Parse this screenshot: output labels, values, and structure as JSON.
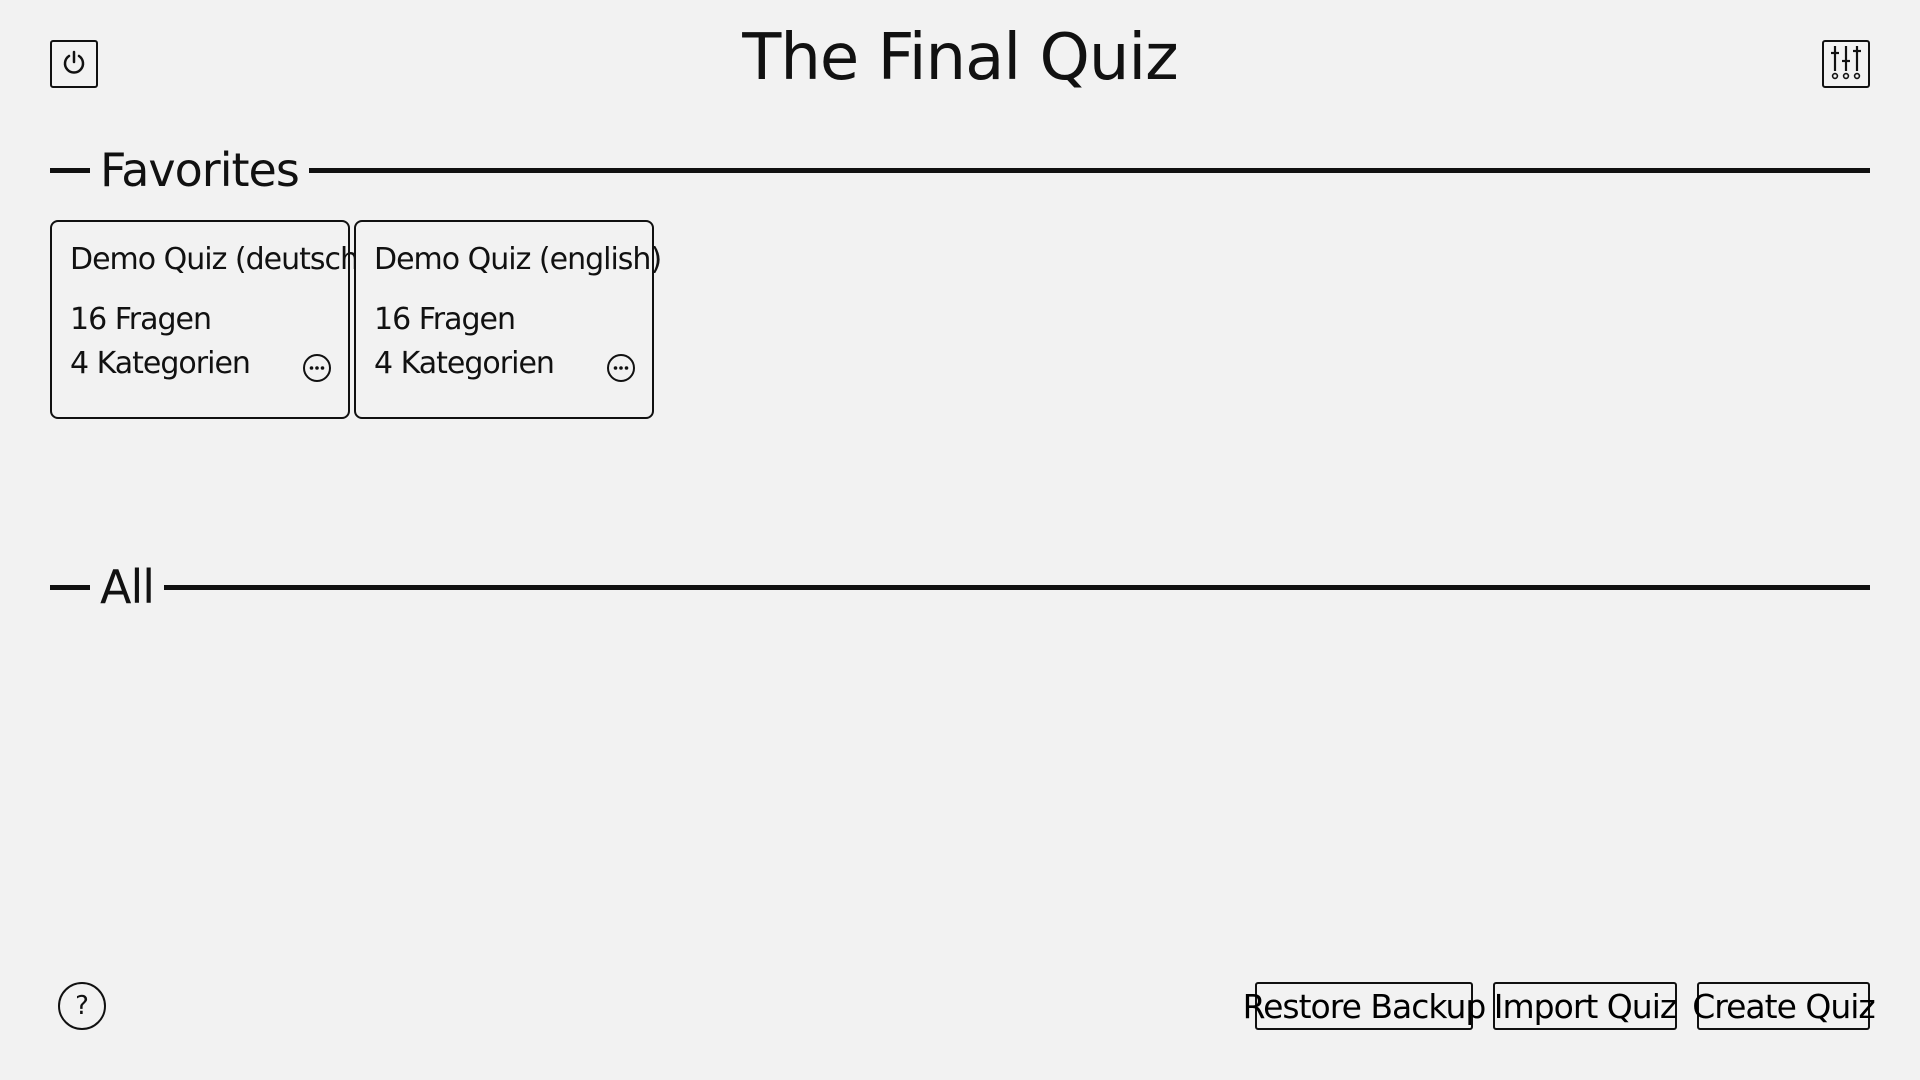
{
  "header": {
    "title": "The Final Quiz",
    "left_icon": "power-icon",
    "right_icon": "sliders-icon"
  },
  "sections": {
    "favorites": {
      "label": "Favorites"
    },
    "all": {
      "label": "All"
    }
  },
  "favorites": [
    {
      "title": "Demo Quiz (deutsch)",
      "questions": "16 Fragen",
      "categories": "4 Kategorien",
      "menu_icon": "more-options-icon"
    },
    {
      "title": "Demo Quiz (english)",
      "questions": "16 Fragen",
      "categories": "4 Kategorien",
      "menu_icon": "more-options-icon"
    }
  ],
  "footer": {
    "help_label": "?",
    "restore_label": "Restore Backup",
    "import_label": "Import Quiz",
    "create_label": "Create Quiz"
  },
  "colors": {
    "background": "#f2f2f2",
    "ink": "#111111"
  }
}
